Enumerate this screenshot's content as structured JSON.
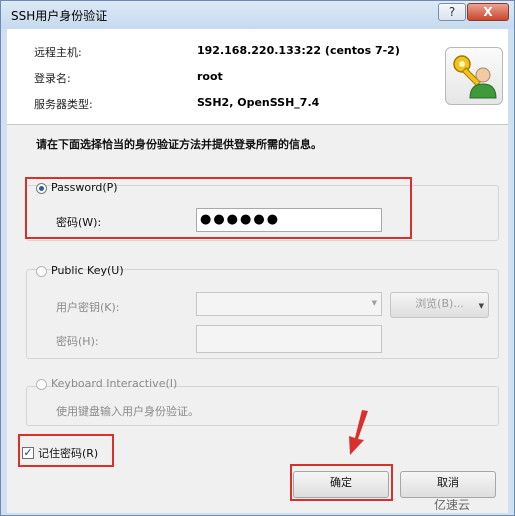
{
  "window": {
    "title": "SSH用户身份验证",
    "help_label": "?",
    "close_label": "X"
  },
  "info": {
    "host_label": "远程主机:",
    "host_value": "192.168.220.133:22 (centos 7-2)",
    "login_label": "登录名:",
    "login_value": "root",
    "server_label": "服务器类型:",
    "server_value": "SSH2, OpenSSH_7.4"
  },
  "instruction": "请在下面选择恰当的身份验证方法并提供登录所需的信息。",
  "password_section": {
    "radio_label": "Password(P)",
    "selected": true,
    "field_label": "密码(W):",
    "field_value": "●●●●●●"
  },
  "publickey_section": {
    "radio_label": "Public Key(U)",
    "selected": false,
    "user_key_label": "用户密钥(K):",
    "user_key_value": "",
    "browse_label": "浏览(B)...",
    "passphrase_label": "密码(H):",
    "passphrase_value": ""
  },
  "keyboard_section": {
    "radio_label": "Keyboard Interactive(I)",
    "selected": false,
    "description": "使用键盘输入用户身份验证。"
  },
  "remember": {
    "label": "记住密码(R)",
    "checked": true,
    "check_mark": "✓"
  },
  "buttons": {
    "ok": "确定",
    "cancel": "取消"
  },
  "watermark": "亿速云",
  "colors": {
    "annotation_red": "#d9302c",
    "title_bg": "#cfe0f0"
  }
}
